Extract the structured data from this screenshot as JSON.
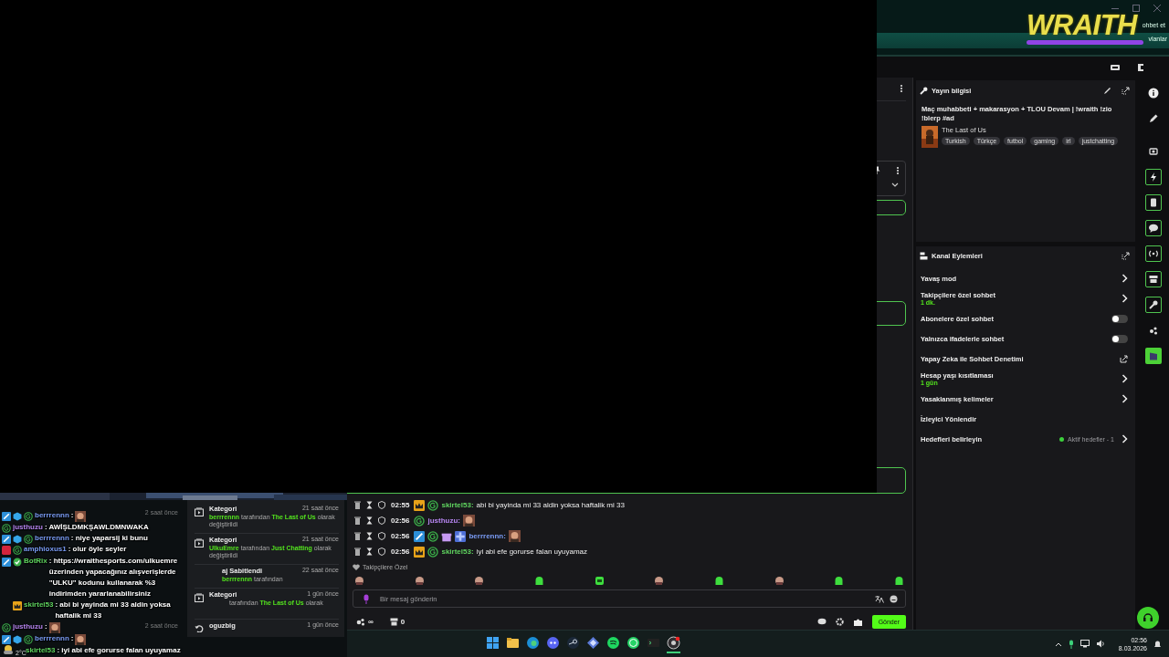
{
  "header": {
    "logo": "WRAITH",
    "fragments": [
      "ohbet et",
      "vlanlar"
    ]
  },
  "stream_preview": {
    "weather": "2°C",
    "background_feed": [
      {
        "kind": "time",
        "text": "2 saat önce"
      },
      {
        "kind": "time",
        "text": "2 saat önce"
      }
    ],
    "overlay_chat": [
      {
        "badges": [
          {
            "kind": "sword"
          },
          {
            "kind": "cube"
          },
          {
            "kind": "g"
          }
        ],
        "user": "berrrennn",
        "color": "#7a9cf5",
        "text": ":",
        "emote": true
      },
      {
        "badges": [
          {
            "kind": "g"
          }
        ],
        "user": "justhuzu",
        "color": "#b685f0",
        "text": ": AWİŞLDMKŞAWLDMNWAKA"
      },
      {
        "badges": [
          {
            "kind": "sword"
          },
          {
            "kind": "cube"
          },
          {
            "kind": "g"
          }
        ],
        "user": "berrrennn",
        "color": "#7a9cf5",
        "text": ": niye yaparsij ki bunu"
      },
      {
        "badges": [
          {
            "kind": "heart"
          },
          {
            "kind": "g"
          }
        ],
        "user": "amphioxus1",
        "color": "#7a9cf5",
        "text": ": olur öyle seyler"
      },
      {
        "badges": [
          {
            "kind": "sword"
          },
          {
            "kind": "check"
          }
        ],
        "user": "BotRix",
        "color": "#5fd35f",
        "text": ": https://wraithesports.com/ulkuemre üzerinden yapacağınız alışverişlerde \"ULKU\" kodunu kullanarak %3 indirimden yararlanabilirsiniz"
      },
      {
        "badges": [
          {
            "kind": "crown"
          }
        ],
        "user": "skirtel53",
        "color": "#5fd35f",
        "text": ": abi bi yayinda mi 33 aldin yoksa haftalik mi 33"
      },
      {
        "badges": [
          {
            "kind": "g"
          }
        ],
        "user": "justhuzu",
        "color": "#b685f0",
        "text": ":",
        "emote": true
      },
      {
        "badges": [
          {
            "kind": "sword"
          },
          {
            "kind": "cube"
          },
          {
            "kind": "g"
          }
        ],
        "user": "berrrennn",
        "color": "#7a9cf5",
        "text": ":",
        "emote": true
      },
      {
        "user": "skirtel53",
        "color": "#5fd35f",
        "text": ": iyi abi efe gorurse falan uyuyamaz"
      }
    ],
    "activity": [
      {
        "kind": "category",
        "title": "Kategori",
        "time": "21 saat önce",
        "actor": "berrrennn",
        "by": "tarafından",
        "target": "The Last of Us",
        "rest": "olarak değiştirildi"
      },
      {
        "kind": "category",
        "title": "Kategori",
        "time": "21 saat önce",
        "actor": "UlkuEmre",
        "by": "tarafından",
        "target": "Just Chatting",
        "rest": "olarak değiştirildi"
      },
      {
        "kind": "pin",
        "title": "aj Sabitlendi",
        "time": "22 saat önce",
        "actor": "berrrennn",
        "by": "tarafından"
      },
      {
        "kind": "category",
        "title": "Kategori",
        "time": "1 gün önce",
        "by": "tarafından",
        "target": "The Last of Us",
        "rest": "olarak"
      },
      {
        "kind": "raid",
        "title": "oguzbig",
        "time": "1 gün önce"
      }
    ]
  },
  "chat": {
    "messages": [
      {
        "time": "02:55",
        "badges": [
          {
            "kind": "crown"
          },
          {
            "kind": "g"
          }
        ],
        "user": "skirtel53:",
        "color": "#5fd35f",
        "text": "abi bi yayinda mi 33 aldin yoksa haftalik mi 33"
      },
      {
        "time": "02:56",
        "badges": [
          {
            "kind": "g"
          }
        ],
        "user": "justhuzu:",
        "color": "#b685f0",
        "emote": true
      },
      {
        "time": "02:56",
        "badges": [
          {
            "kind": "sword"
          },
          {
            "kind": "g"
          },
          {
            "kind": "gift"
          },
          {
            "kind": "cross"
          }
        ],
        "user": "berrrennn:",
        "color": "#7a9cf5",
        "emote": true
      },
      {
        "time": "02:56",
        "badges": [
          {
            "kind": "crown"
          },
          {
            "kind": "g"
          }
        ],
        "user": "skirtel53:",
        "color": "#5fd35f",
        "text": "iyi abi efe gorurse falan uyuyamaz"
      }
    ],
    "emote_section": "Takipçilere Özel",
    "emotes": [
      {
        "kind": "face"
      },
      {
        "kind": "face"
      },
      {
        "kind": "face"
      },
      {
        "kind": "blob"
      },
      {
        "kind": "box"
      },
      {
        "kind": "face"
      },
      {
        "kind": "blob"
      },
      {
        "kind": "face"
      },
      {
        "kind": "blob"
      },
      {
        "kind": "blob"
      }
    ],
    "input": {
      "placeholder": "Bir mesaj gönderin"
    },
    "points": "∞",
    "bits": "0",
    "send": "Gönder"
  },
  "stream_info": {
    "title": "Yayın bilgisi",
    "stream_title": "Maç muhabbeti + makarasyon + TLOU Devam | !wraith !zio !blerp #ad",
    "game": "The Last of Us",
    "tags": [
      "Turkish",
      "Türkçe",
      "futbol",
      "gaming",
      "irl",
      "justchatting"
    ]
  },
  "channel_actions": {
    "title": "Kanal Eylemleri",
    "items": [
      {
        "kind": "link",
        "label": "Yavaş mod"
      },
      {
        "kind": "link",
        "label": "Takipçilere özel sohbet",
        "sub": "1 dk."
      },
      {
        "kind": "toggle",
        "label": "Abonelere özel sohbet",
        "on": false
      },
      {
        "kind": "toggle",
        "label": "Yalnızca ifadelerle sohbet",
        "on": false
      },
      {
        "kind": "external",
        "label": "Yapay Zeka ile Sohbet Denetimi"
      },
      {
        "kind": "link",
        "label": "Hesap yaşı kısıtlaması",
        "sub": "1 gün"
      },
      {
        "kind": "link",
        "label": "Yasaklanmış kelimeler"
      },
      {
        "kind": "plain",
        "label": "İzleyici Yönlendir"
      },
      {
        "kind": "goal",
        "label": "Hedefleri belirleyin",
        "status": "Aktif hedefler - 1"
      }
    ]
  },
  "rail": [
    {
      "kind": "info",
      "selected": false
    },
    {
      "kind": "pencil",
      "selected": false
    },
    {
      "kind": "camera",
      "selected": false
    },
    {
      "kind": "bolt",
      "selected": false
    },
    {
      "kind": "tablet",
      "selected": false
    },
    {
      "kind": "chat",
      "selected": false
    },
    {
      "kind": "broadcast",
      "selected": false
    },
    {
      "kind": "store",
      "selected": false
    },
    {
      "kind": "wrench",
      "selected": false
    },
    {
      "kind": "dots",
      "selected": false
    },
    {
      "kind": "film",
      "selected": true
    }
  ],
  "taskbar": {
    "apps": [
      {
        "kind": "windows",
        "active": false
      },
      {
        "kind": "folder",
        "active": false
      },
      {
        "kind": "edge",
        "active": false
      },
      {
        "kind": "discord",
        "active": false
      },
      {
        "kind": "steam",
        "active": false
      },
      {
        "kind": "grid",
        "active": false
      },
      {
        "kind": "spotify",
        "active": false
      },
      {
        "kind": "whatsapp",
        "active": false
      },
      {
        "kind": "terminal",
        "active": false
      },
      {
        "kind": "obs",
        "active": true
      }
    ],
    "time": "02:56",
    "date": "8.03.2026"
  }
}
